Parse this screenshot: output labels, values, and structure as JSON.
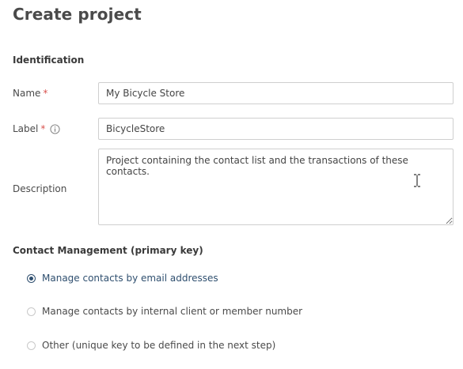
{
  "page": {
    "title": "Create project"
  },
  "identification": {
    "section_title": "Identification",
    "name": {
      "label": "Name",
      "required_mark": "*",
      "value": "My Bicycle Store"
    },
    "label_field": {
      "label": "Label",
      "required_mark": "*",
      "info_icon": "info-icon",
      "value": "BicycleStore"
    },
    "description": {
      "label": "Description",
      "value": "Project containing the contact list and the transactions of these contacts."
    }
  },
  "contact_management": {
    "section_title": "Contact Management (primary key)",
    "options": [
      {
        "label": "Manage contacts by email addresses",
        "selected": true
      },
      {
        "label": "Manage contacts by internal client or member number",
        "selected": false
      },
      {
        "label": "Other (unique key to be defined in the next step)",
        "selected": false
      }
    ]
  },
  "colors": {
    "accent": "#2f4f6f",
    "required": "#d9534f",
    "border": "#cfcfcf"
  },
  "cursor": {
    "icon": "text-cursor-icon"
  }
}
